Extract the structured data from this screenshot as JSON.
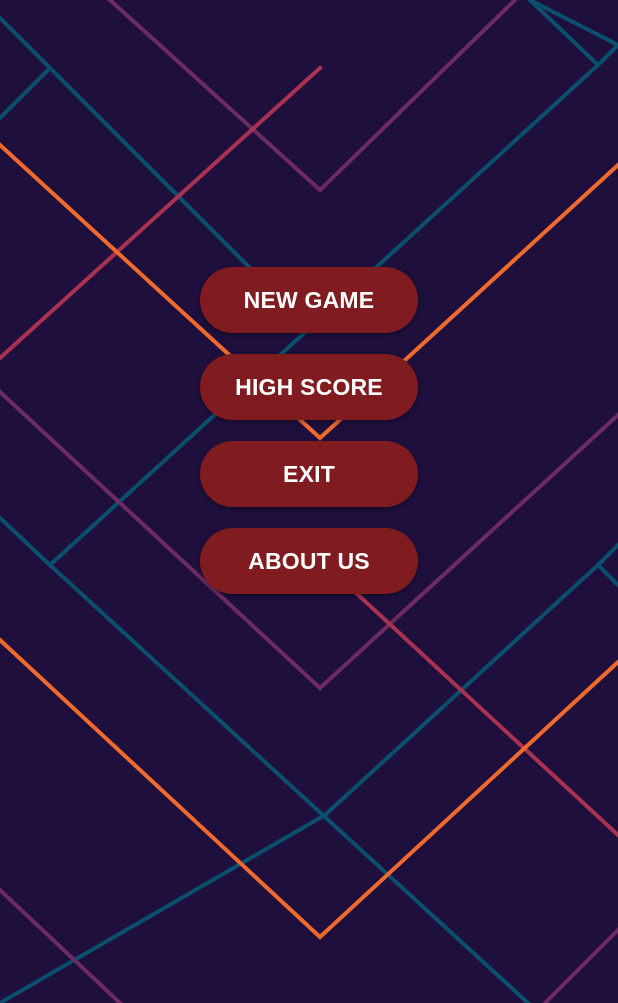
{
  "colors": {
    "background": "#1e0f3d",
    "button": "#801c20",
    "button_text": "#ffffff",
    "line_teal": "#0a4f6e",
    "line_purple": "#6c2b63",
    "line_magenta": "#a8324f",
    "line_orange": "#ef6a2c"
  },
  "menu": {
    "new_game": "NEW GAME",
    "high_score": "HIGH SCORE",
    "exit": "EXIT",
    "about_us": "ABOUT US"
  }
}
